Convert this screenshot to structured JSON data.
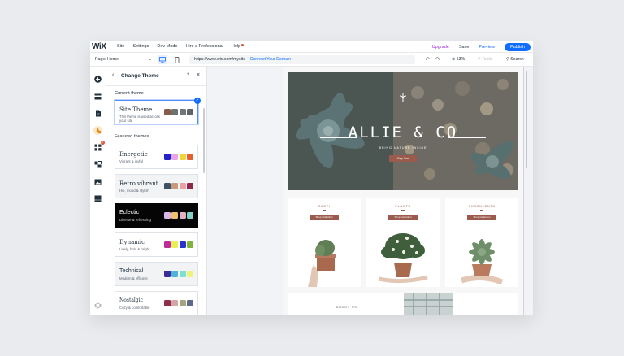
{
  "topbar": {
    "logo": "WiX",
    "nav": [
      "Site",
      "Settings",
      "Dev Mode",
      "Hire a Professional",
      "Help"
    ],
    "upgrade": "Upgrade",
    "save": "Save",
    "preview": "Preview",
    "publish": "Publish"
  },
  "toolbar": {
    "page": "Page: Home",
    "url": "https://www.wix.com/mysite",
    "connect": "Connect Your Domain",
    "zoom": "53%",
    "tools": "Tools",
    "search": "Search"
  },
  "panel": {
    "title": "Change Theme",
    "help": "?",
    "current_label": "Current theme",
    "featured_label": "Featured themes",
    "current": {
      "name": "Site Theme",
      "desc": "This theme is used across your site",
      "colors": [
        "#8a5a4a",
        "#6e7172",
        "#6f7578",
        "#5e6468"
      ]
    },
    "themes": [
      {
        "name": "Energetic",
        "desc": "Vibrant & joyful",
        "colors": [
          "#2323c8",
          "#e9a6e6",
          "#f2d33a",
          "#e5602f"
        ]
      },
      {
        "name": "Retro vibrant",
        "desc": "Hip, mood & stylish",
        "colors": [
          "#3d5068",
          "#c79a7a",
          "#e8a2a6",
          "#8e2846"
        ]
      },
      {
        "name": "Eclectic",
        "desc": "Diverse & refreshing",
        "colors": [
          "#d8b8e8",
          "#f0c06a",
          "#e0b1c2",
          "#7fd2c6"
        ]
      },
      {
        "name": "Dynamic",
        "desc": "Lively, bold & bright",
        "colors": [
          "#c02a9a",
          "#e6ef58",
          "#2a33c9",
          "#7fb33b"
        ]
      },
      {
        "name": "Technical",
        "desc": "Modern & efficient",
        "colors": [
          "#3a2d9a",
          "#4fb3d9",
          "#7ee0d2",
          "#ecf27a"
        ]
      },
      {
        "name": "Nostalgic",
        "desc": "Cozy & comfortable",
        "colors": [
          "#8f2e4c",
          "#d5a6a6",
          "#a6a47a",
          "#5a6a88"
        ]
      }
    ]
  },
  "site": {
    "hero_title": "ALLIE & CO",
    "hero_sub": "BRING NATURE INSIDE",
    "hero_btn": "Shop Now",
    "products": [
      {
        "title": "CACTI",
        "btn": "Shop Collection"
      },
      {
        "title": "PLANTS",
        "btn": "Shop Collection"
      },
      {
        "title": "SUCCULENTS",
        "btn": "Shop Collection"
      }
    ],
    "about": "ABOUT US",
    "accent": "#9b5b4c"
  },
  "colors": {
    "blue": "#116dff",
    "purple": "#9a27d5"
  }
}
